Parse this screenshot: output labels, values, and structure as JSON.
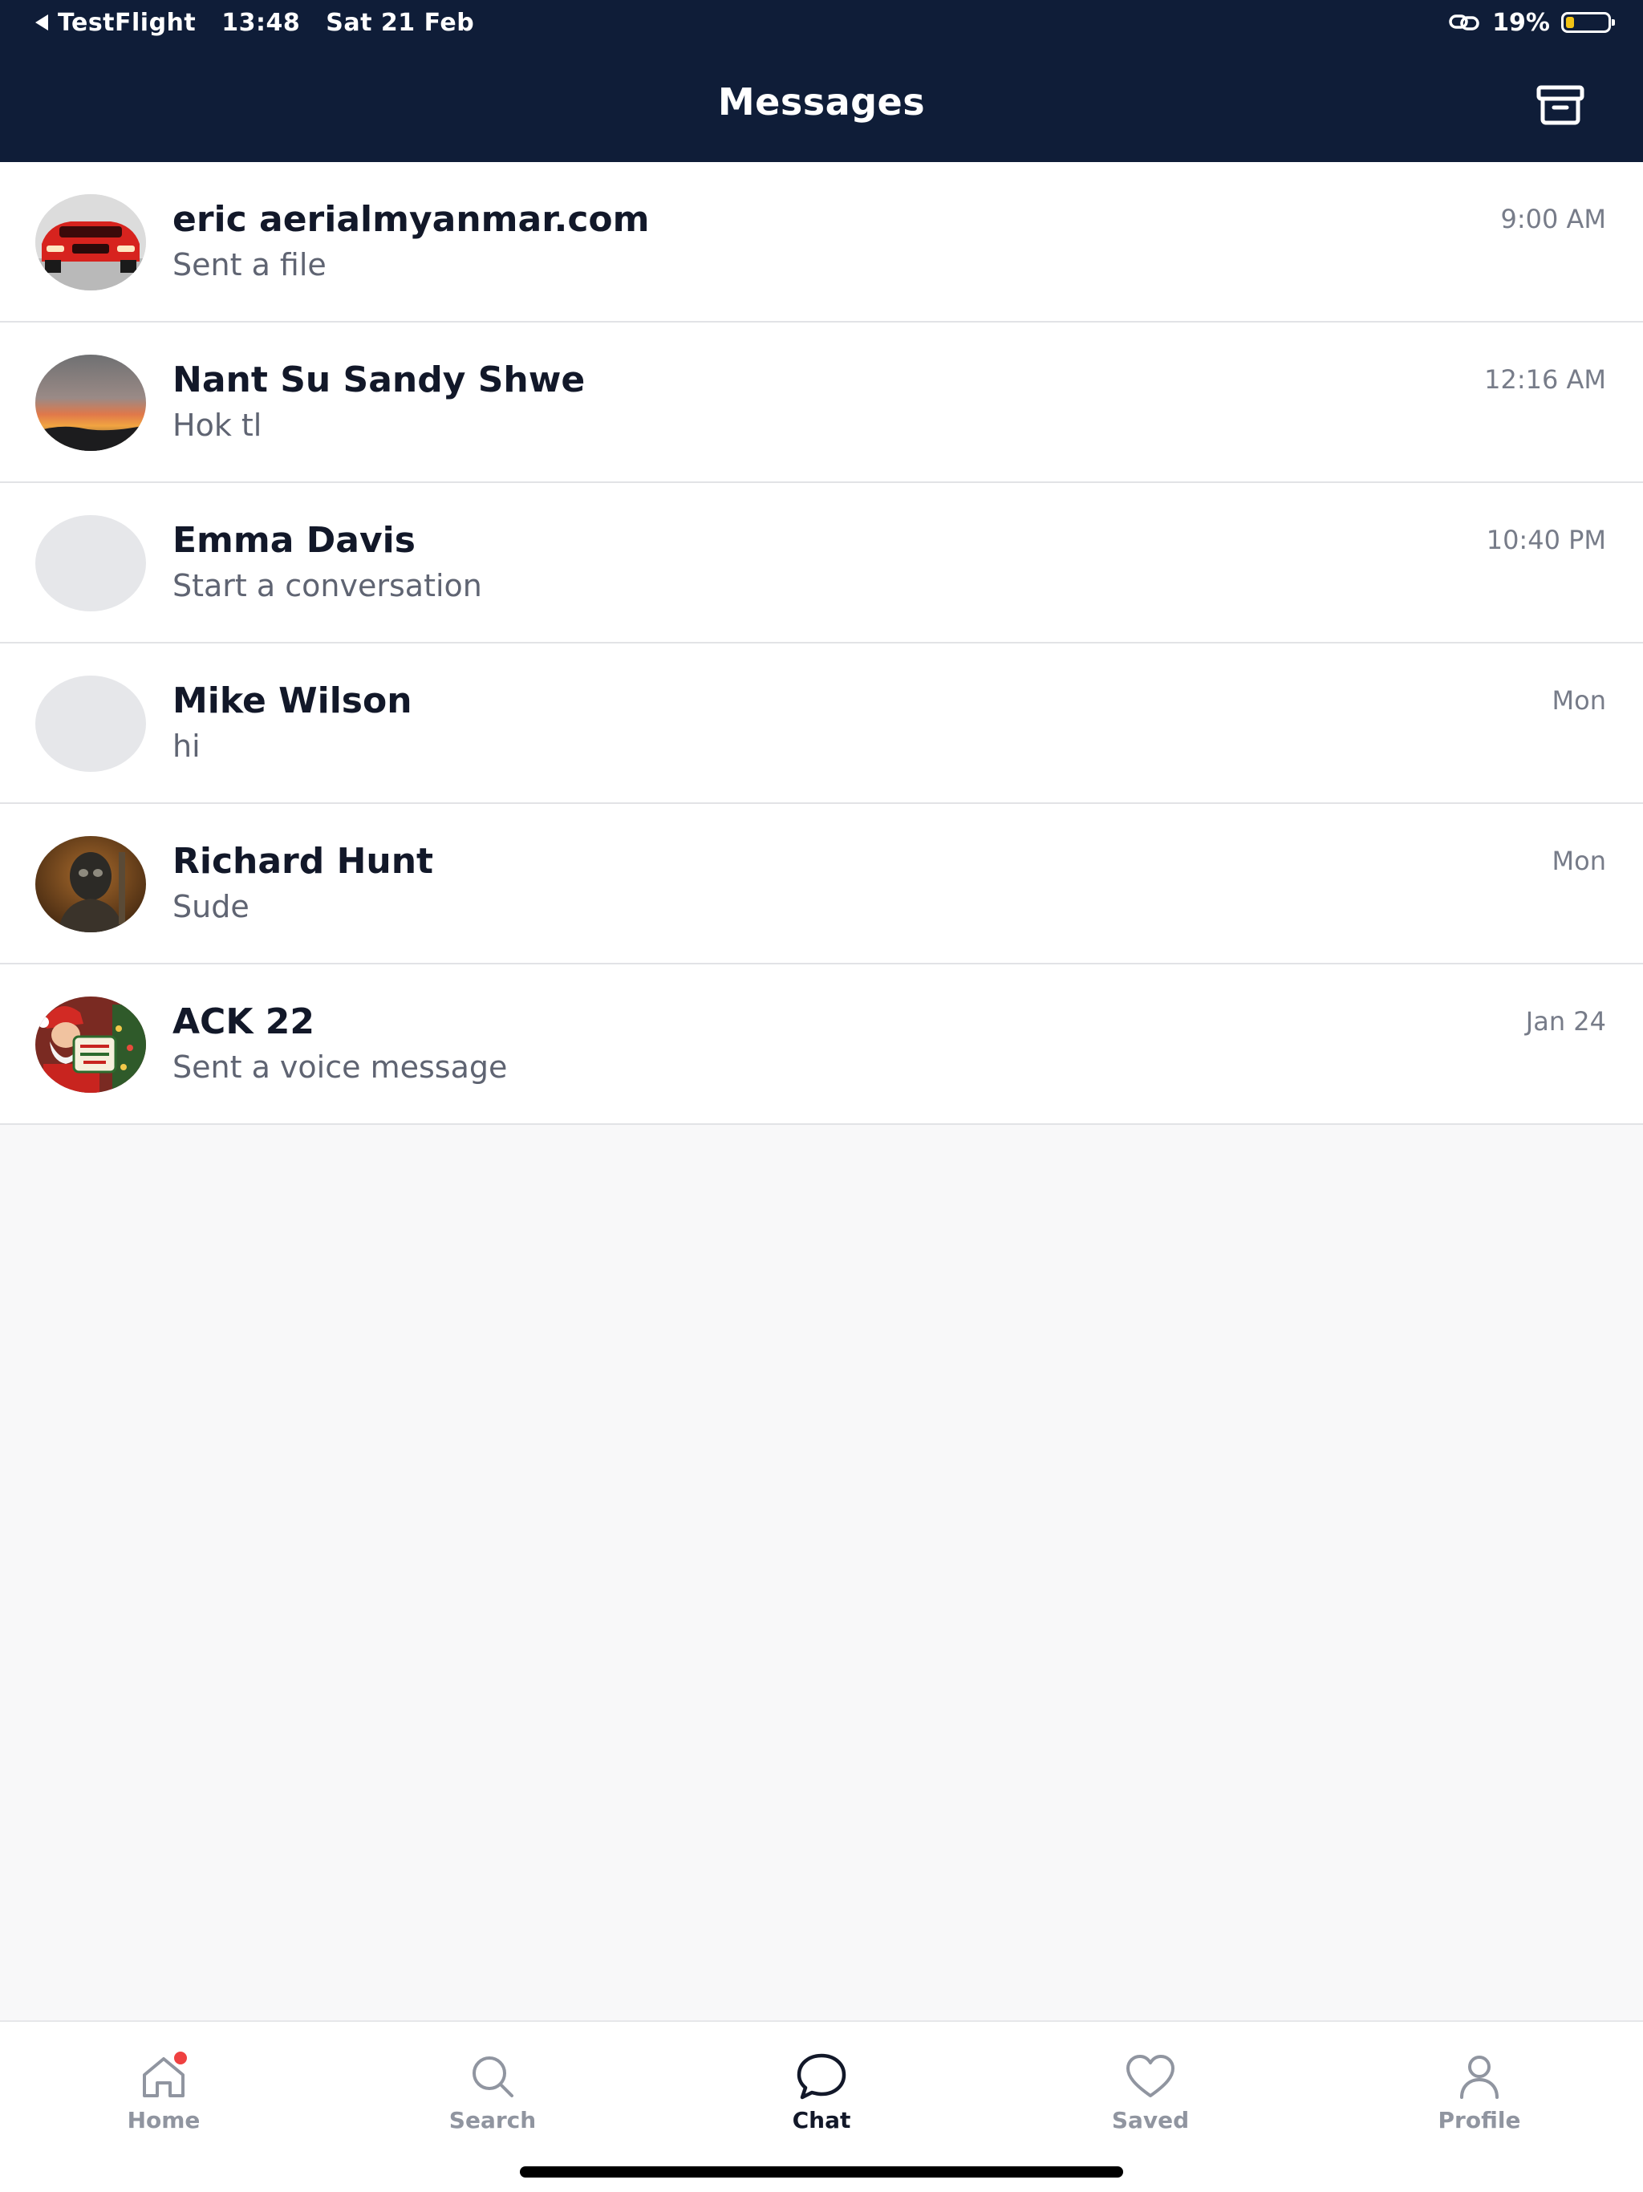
{
  "status_bar": {
    "back_app": "TestFlight",
    "time": "13:48",
    "date": "Sat 21 Feb",
    "battery_percent": "19%",
    "battery_level": 0.19,
    "icons": [
      "back-triangle-icon",
      "link-icon",
      "battery-icon"
    ]
  },
  "header": {
    "title": "Messages",
    "archive_icon": "archive-icon"
  },
  "conversations": [
    {
      "name": "eric aerialmyanmar.com",
      "preview": "Sent a file",
      "time": "9:00 AM",
      "avatar": "red-car-photo"
    },
    {
      "name": "Nant Su Sandy Shwe",
      "preview": "Hok tl",
      "time": "12:16 AM",
      "avatar": "sunset-photo"
    },
    {
      "name": "Emma Davis",
      "preview": "Start a conversation",
      "time": "10:40 PM",
      "avatar": "placeholder"
    },
    {
      "name": "Mike Wilson",
      "preview": "hi",
      "time": "Mon",
      "avatar": "placeholder"
    },
    {
      "name": "Richard Hunt",
      "preview": "Sude",
      "time": "Mon",
      "avatar": "armored-figure-photo"
    },
    {
      "name": "ACK 22",
      "preview": "Sent a voice message",
      "time": "Jan 24",
      "avatar": "santa-photo"
    }
  ],
  "tabs": [
    {
      "label": "Home",
      "icon": "home-icon",
      "badge": true
    },
    {
      "label": "Search",
      "icon": "search-icon"
    },
    {
      "label": "Chat",
      "icon": "chat-bubble-icon",
      "active": true
    },
    {
      "label": "Saved",
      "icon": "heart-icon"
    },
    {
      "label": "Profile",
      "icon": "person-icon"
    }
  ],
  "colors": {
    "header_bg": "#0f1d38",
    "active_tab": "#121829",
    "inactive_tab": "#9095a0",
    "badge": "#ef4141",
    "battery_fill": "#f2c315"
  }
}
